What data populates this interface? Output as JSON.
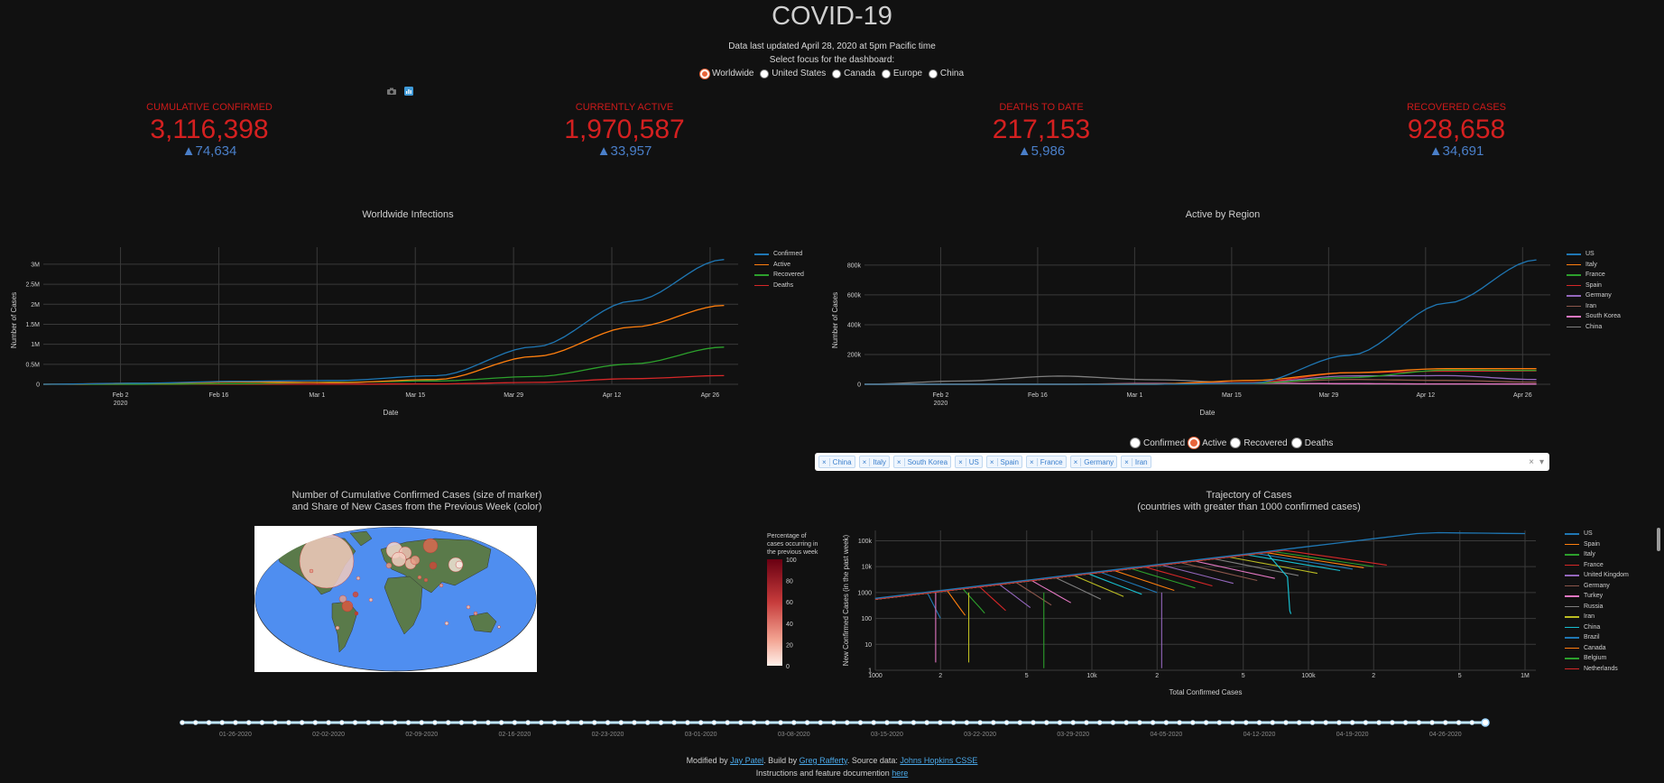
{
  "header": {
    "title": "COVID-19",
    "updated": "Data last updated April 28, 2020 at 5pm Pacific time",
    "focus_prompt": "Select focus for the dashboard:"
  },
  "focus_options": [
    {
      "label": "Worldwide",
      "selected": true
    },
    {
      "label": "United States",
      "selected": false
    },
    {
      "label": "Canada",
      "selected": false
    },
    {
      "label": "Europe",
      "selected": false
    },
    {
      "label": "China",
      "selected": false
    }
  ],
  "modebar": {
    "icons": [
      "camera-icon",
      "plotly-logo-icon"
    ]
  },
  "stats": [
    {
      "label": "CUMULATIVE CONFIRMED",
      "value": "3,116,398",
      "delta": "▲74,634"
    },
    {
      "label": "CURRENTLY ACTIVE",
      "value": "1,970,587",
      "delta": "▲33,957"
    },
    {
      "label": "DEATHS TO DATE",
      "value": "217,153",
      "delta": "▲5,986"
    },
    {
      "label": "RECOVERED CASES",
      "value": "928,658",
      "delta": "▲34,691"
    }
  ],
  "colors": {
    "stat_label": "#cc1a1a",
    "stat_value": "#d42020",
    "delta": "#4a7fc9",
    "blue": "#1f77b4",
    "orange": "#ff7f0e",
    "green": "#2ca02c",
    "red": "#d62728",
    "purple": "#9467bd",
    "brown": "#8c564b",
    "pink": "#e377c2",
    "gray": "#7f7f7f",
    "ocean": "#4f8ef0",
    "land": "#5a7a4a"
  },
  "chart_data": [
    {
      "type": "line",
      "title": "Worldwide Infections",
      "xlabel": "Date",
      "ylabel": "Number of Cases",
      "x_ticks": [
        "Feb 2\n2020",
        "Feb 16",
        "Mar 1",
        "Mar 15",
        "Mar 29",
        "Apr 12",
        "Apr 26"
      ],
      "y_ticks": [
        "0",
        "0.5M",
        "1M",
        "1.5M",
        "2M",
        "2.5M",
        "3M"
      ],
      "ylim": [
        0,
        3200000
      ],
      "x": [
        "2020-01-22",
        "2020-02-05",
        "2020-02-19",
        "2020-03-04",
        "2020-03-18",
        "2020-04-01",
        "2020-04-15",
        "2020-04-28"
      ],
      "series": [
        {
          "name": "Confirmed",
          "color": "#1f77b4",
          "values": [
            555,
            28000,
            76000,
            95000,
            215000,
            935000,
            2080000,
            3116398
          ]
        },
        {
          "name": "Active",
          "color": "#ff7f0e",
          "values": [
            510,
            25000,
            57000,
            41000,
            120000,
            695000,
            1430000,
            1970587
          ]
        },
        {
          "name": "Recovered",
          "color": "#2ca02c",
          "values": [
            28,
            1120,
            16000,
            52000,
            84000,
            193000,
            510000,
            928658
          ]
        },
        {
          "name": "Deaths",
          "color": "#d62728",
          "values": [
            17,
            560,
            2120,
            3200,
            8800,
            47000,
            140000,
            217153
          ]
        }
      ],
      "legend": "right"
    },
    {
      "type": "line",
      "title": "Active by Region",
      "xlabel": "Date",
      "ylabel": "Number of Cases",
      "x_ticks": [
        "Feb 2\n2020",
        "Feb 16",
        "Mar 1",
        "Mar 15",
        "Mar 29",
        "Apr 12",
        "Apr 26"
      ],
      "y_ticks": [
        "0",
        "200k",
        "400k",
        "600k",
        "800k"
      ],
      "ylim": [
        0,
        860000
      ],
      "x": [
        "2020-01-22",
        "2020-02-05",
        "2020-02-19",
        "2020-03-04",
        "2020-03-18",
        "2020-04-01",
        "2020-04-15",
        "2020-04-28"
      ],
      "series": [
        {
          "name": "US",
          "color": "#1f77b4",
          "values": [
            0,
            10,
            20,
            120,
            7500,
            195000,
            545000,
            835000
          ]
        },
        {
          "name": "Italy",
          "color": "#ff7f0e",
          "values": [
            0,
            0,
            3,
            2500,
            26000,
            78000,
            105000,
            105000
          ]
        },
        {
          "name": "France",
          "color": "#2ca02c",
          "values": [
            0,
            5,
            5,
            200,
            7200,
            45000,
            95000,
            93000
          ]
        },
        {
          "name": "Spain",
          "color": "#d62728",
          "values": [
            0,
            1,
            2,
            170,
            12000,
            78000,
            88000,
            90000
          ]
        },
        {
          "name": "Germany",
          "color": "#9467bd",
          "values": [
            0,
            12,
            6,
            230,
            11000,
            56000,
            58000,
            32000
          ]
        },
        {
          "name": "Iran",
          "color": "#8c564b",
          "values": [
            0,
            0,
            0,
            2400,
            10000,
            32000,
            26000,
            14000
          ]
        },
        {
          "name": "South Korea",
          "color": "#e377c2",
          "values": [
            0,
            15,
            90,
            5500,
            7000,
            4200,
            2300,
            1800
          ]
        },
        {
          "name": "China",
          "color": "#7f7f7f",
          "values": [
            510,
            22000,
            55000,
            30000,
            8000,
            2200,
            1100,
            700
          ]
        }
      ],
      "legend": "right"
    },
    {
      "type": "scatter",
      "title": "Number of Cumulative Confirmed Cases (size of marker)\nand Share of New Cases from the Previous Week (color)",
      "colorbar": {
        "title": "Percentage of cases occurring in the previous week",
        "ticks": [
          "100",
          "80",
          "60",
          "40",
          "20",
          "0"
        ]
      }
    },
    {
      "type": "line",
      "title": "Trajectory of Cases\n(countries with greater than 1000 confirmed cases)",
      "xlabel": "Total Confirmed Cases",
      "ylabel": "New Confirmed Cases (in the past week)",
      "x_ticks": [
        "1000",
        "2",
        "5",
        "10k",
        "2",
        "5",
        "100k",
        "2",
        "5",
        "1M"
      ],
      "y_ticks": [
        "100k",
        "10k",
        "1000",
        "100",
        "10",
        "1"
      ],
      "log_x": true,
      "log_y": true,
      "series": [
        {
          "name": "US",
          "color": "#1f77b4"
        },
        {
          "name": "Spain",
          "color": "#ff7f0e"
        },
        {
          "name": "Italy",
          "color": "#2ca02c"
        },
        {
          "name": "France",
          "color": "#d62728"
        },
        {
          "name": "United Kingdom",
          "color": "#9467bd"
        },
        {
          "name": "Germany",
          "color": "#8c564b"
        },
        {
          "name": "Turkey",
          "color": "#e377c2"
        },
        {
          "name": "Russia",
          "color": "#7f7f7f"
        },
        {
          "name": "Iran",
          "color": "#bcbd22"
        },
        {
          "name": "China",
          "color": "#17becf"
        },
        {
          "name": "Brazil",
          "color": "#1f77b4"
        },
        {
          "name": "Canada",
          "color": "#ff7f0e"
        },
        {
          "name": "Belgium",
          "color": "#2ca02c"
        },
        {
          "name": "Netherlands",
          "color": "#d62728"
        }
      ],
      "legend": "right"
    }
  ],
  "metric_options": [
    {
      "label": "Confirmed",
      "selected": false
    },
    {
      "label": "Active",
      "selected": true
    },
    {
      "label": "Recovered",
      "selected": false
    },
    {
      "label": "Deaths",
      "selected": false
    }
  ],
  "country_chips": [
    "China",
    "Italy",
    "South Korea",
    "US",
    "Spain",
    "France",
    "Germany",
    "Iran"
  ],
  "dropdown": {
    "clear": "×",
    "arrow": "▾"
  },
  "slider": {
    "labels": [
      "01-26-2020",
      "02-02-2020",
      "02-09-2020",
      "02-16-2020",
      "02-23-2020",
      "03-01-2020",
      "03-08-2020",
      "03-15-2020",
      "03-22-2020",
      "03-29-2020",
      "04-05-2020",
      "04-12-2020",
      "04-19-2020",
      "04-26-2020"
    ],
    "value": "04-28-2020"
  },
  "footer": {
    "line1_pre": "Modified by ",
    "author1": "Jay Patel",
    "line1_mid": ". Build by ",
    "author2": "Greg Rafferty",
    "line1_mid2": ". Source data: ",
    "source": "Johns Hopkins CSSE",
    "line2_pre": "Instructions and feature documention ",
    "link": "here"
  }
}
